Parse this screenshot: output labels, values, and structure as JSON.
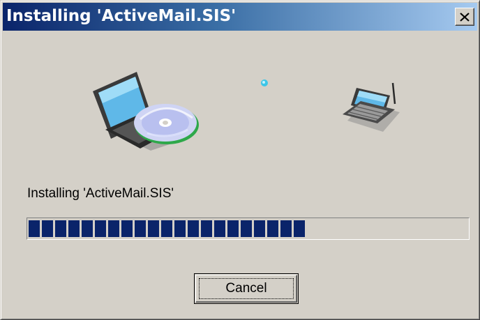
{
  "window": {
    "title": "Installing 'ActiveMail.SIS'",
    "close_icon": "close-x-icon"
  },
  "illustration": {
    "source_icon": "laptop-with-cd-icon",
    "target_icon": "handheld-device-icon",
    "transfer_icon": "transfer-dot-icon"
  },
  "status": {
    "message": "Installing 'ActiveMail.SIS'"
  },
  "progress": {
    "fraction": 0.63,
    "color": "#0a246a"
  },
  "buttons": {
    "cancel_label": "Cancel"
  }
}
